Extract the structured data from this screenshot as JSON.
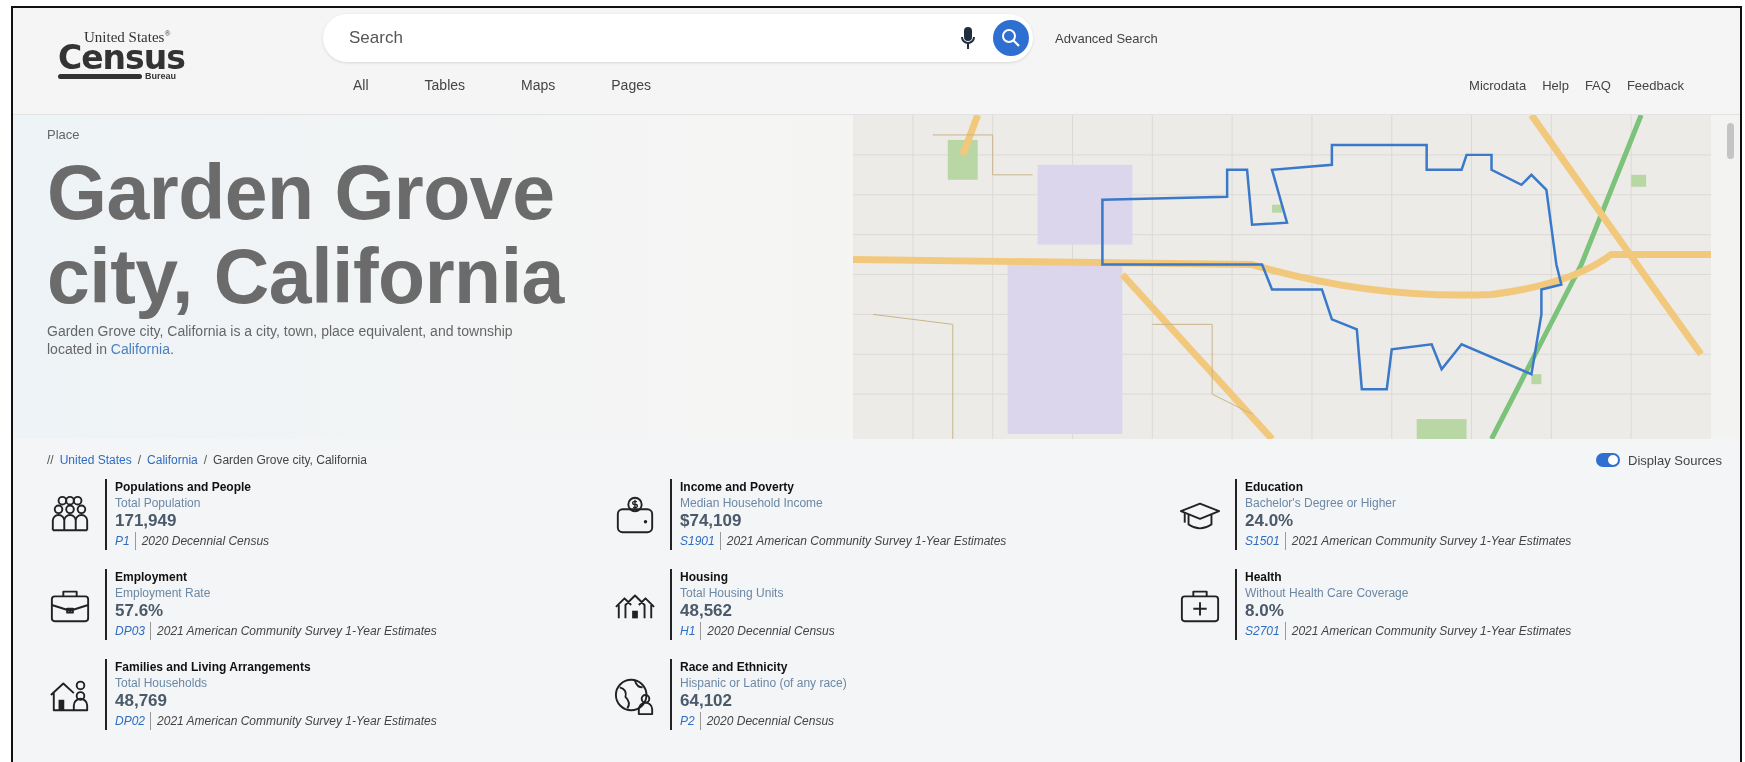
{
  "logo": {
    "top": "United States$^{®}$",
    "main": "Census",
    "bottom": "Bureau"
  },
  "search": {
    "placeholder": "Search",
    "advanced": "Advanced Search"
  },
  "search_tabs": [
    {
      "label": "All"
    },
    {
      "label": "Tables"
    },
    {
      "label": "Maps"
    },
    {
      "label": "Pages"
    }
  ],
  "utility_links": [
    "Microdata",
    "Help",
    "FAQ",
    "Feedback"
  ],
  "hero": {
    "eyebrow": "Place",
    "title_lines": [
      "Garden Grove",
      "city, California"
    ],
    "description": "Garden Grove city, California is a city, town, place equivalent, and township located in ",
    "description_link": "California",
    "description_end": "."
  },
  "breadcrumb": [
    {
      "label": "//",
      "kind": "marker"
    },
    {
      "label": "United States",
      "kind": "link"
    },
    {
      "label": "/",
      "kind": "separator"
    },
    {
      "label": "California",
      "kind": "link"
    },
    {
      "label": "/",
      "kind": "separator"
    },
    {
      "label": "Garden Grove city, California",
      "kind": "current"
    }
  ],
  "display_sources": {
    "label": "Display Sources",
    "on": true
  },
  "stats": [
    {
      "kind": "population",
      "category": "Populations and People",
      "measure": "Total Population",
      "value": "171,949",
      "table": "P1",
      "source": "2020 Decennial Census"
    },
    {
      "kind": "income",
      "category": "Income and Poverty",
      "measure": "Median Household Income",
      "value": "$74,109",
      "table": "S1901",
      "source": "2021 American Community Survey 1-Year Estimates"
    },
    {
      "kind": "education",
      "category": "Education",
      "measure": "Bachelor's Degree or Higher",
      "value": "24.0%",
      "table": "S1501",
      "source": "2021 American Community Survey 1-Year Estimates"
    },
    {
      "kind": "employment",
      "category": "Employment",
      "measure": "Employment Rate",
      "value": "57.6%",
      "table": "DP03",
      "source": "2021 American Community Survey 1-Year Estimates"
    },
    {
      "kind": "housing",
      "category": "Housing",
      "measure": "Total Housing Units",
      "value": "48,562",
      "table": "H1",
      "source": "2020 Decennial Census"
    },
    {
      "kind": "health",
      "category": "Health",
      "measure": "Without Health Care Coverage",
      "value": "8.0%",
      "table": "S2701",
      "source": "2021 American Community Survey 1-Year Estimates"
    },
    {
      "kind": "families",
      "category": "Families and Living Arrangements",
      "measure": "Total Households",
      "value": "48,769",
      "table": "DP02",
      "source": "2021 American Community Survey 1-Year Estimates"
    },
    {
      "kind": "race",
      "category": "Race and Ethnicity",
      "measure": "Hispanic or Latino (of any race)",
      "value": "64,102",
      "table": "P2",
      "source": "2020 Decennial Census"
    }
  ]
}
